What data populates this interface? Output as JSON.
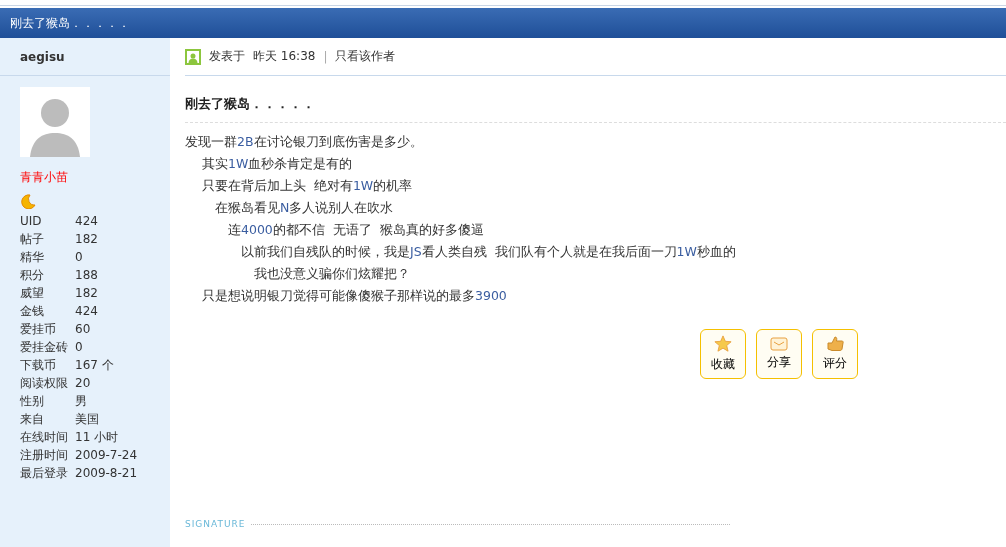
{
  "window": {
    "title": "刚去了猴岛．．．．．"
  },
  "author": {
    "username": "aegisu",
    "group": "青青小苗",
    "stats": [
      {
        "label": "UID",
        "value": "424"
      },
      {
        "label": "帖子",
        "value": "182"
      },
      {
        "label": "精华",
        "value": "0"
      },
      {
        "label": "积分",
        "value": "188"
      },
      {
        "label": "威望",
        "value": "182"
      },
      {
        "label": "金钱",
        "value": "424"
      },
      {
        "label": "爱挂币",
        "value": "60"
      },
      {
        "label": "爱挂金砖",
        "value": "0"
      },
      {
        "label": "下载币",
        "value": "167 个"
      },
      {
        "label": "阅读权限",
        "value": "20"
      },
      {
        "label": "性别",
        "value": "男"
      },
      {
        "label": "来自",
        "value": "美国"
      },
      {
        "label": "在线时间",
        "value": "11 小时"
      },
      {
        "label": "注册时间",
        "value": "2009-7-24"
      },
      {
        "label": "最后登录",
        "value": "2009-8-21"
      }
    ]
  },
  "post": {
    "posted": "发表于",
    "time": "昨天 16:38",
    "separator": "|",
    "only_author": "只看该作者",
    "title": "刚去了猴岛．．．．．",
    "lines": [
      "发现一群2B在讨论银刀到底伤害是多少。",
      "　 其实1W血秒杀肯定是有的",
      "　 只要在背后加上头  绝对有1W的机率",
      "　　 在猴岛看见N多人说别人在吹水",
      "　　　 连4000的都不信  无语了  猴岛真的好多傻逼",
      "　　　　 以前我们自残队的时候，我是JS看人类自残  我们队有个人就是在我后面一刀1W秒血的",
      "　　　　　 我也没意义骗你们炫耀把？",
      "　 只是想说明银刀觉得可能像傻猴子那样说的最多3900"
    ],
    "actions": [
      {
        "kind": "favorite",
        "label": "收藏"
      },
      {
        "kind": "share",
        "label": "分享"
      },
      {
        "kind": "rate",
        "label": "评分"
      }
    ],
    "signature_label": "SIGNATURE"
  }
}
